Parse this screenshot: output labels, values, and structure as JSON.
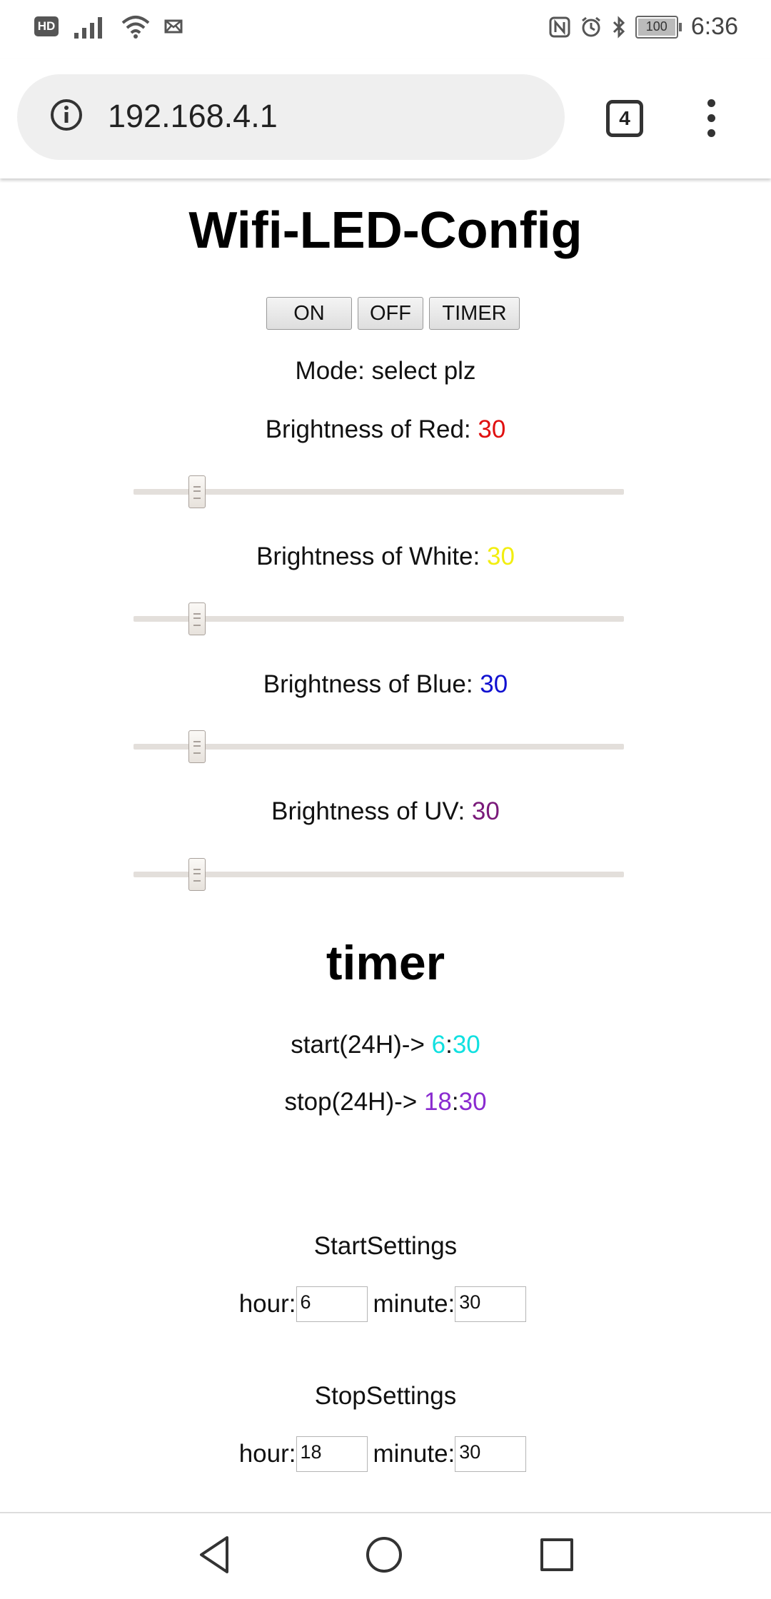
{
  "status_bar": {
    "hd_label": "HD",
    "battery": "100",
    "time": "6:36",
    "icons": [
      "hd-icon",
      "signal-icon",
      "wifi-icon",
      "message-icon",
      "nfc-icon",
      "alarm-icon",
      "bluetooth-icon",
      "battery-icon"
    ]
  },
  "browser": {
    "url": "192.168.4.1",
    "tab_count": "4"
  },
  "page": {
    "title": "Wifi-LED-Config",
    "buttons": {
      "on": "ON",
      "off": "OFF",
      "timer": "TIMER"
    },
    "mode_text": "Mode: select plz",
    "sliders": [
      {
        "label": "Brightness of Red: ",
        "value": "30",
        "color": "#e01010",
        "fraction": 0.13
      },
      {
        "label": "Brightness of White: ",
        "value": "30",
        "color": "#f2ee10",
        "fraction": 0.13
      },
      {
        "label": "Brightness of Blue: ",
        "value": "30",
        "color": "#1010d0",
        "fraction": 0.13
      },
      {
        "label": "Brightness of UV: ",
        "value": "30",
        "color": "#7a1a7a",
        "fraction": 0.13
      }
    ],
    "timer_heading": "timer",
    "start": {
      "label": "start(24H)-> ",
      "hour": "6",
      "sep": ":",
      "minute": "30",
      "color": "#10e0e0"
    },
    "stop": {
      "label": "stop(24H)-> ",
      "hour": "18",
      "sep": ":",
      "minute": "30",
      "color": "#8a2bd0"
    },
    "start_settings": {
      "title": "StartSettings",
      "hour_label": "hour:",
      "hour_value": "6",
      "minute_label": "minute:",
      "minute_value": "30"
    },
    "stop_settings": {
      "title": "StopSettings",
      "hour_label": "hour:",
      "hour_value": "18",
      "minute_label": "minute:",
      "minute_value": "30"
    }
  }
}
